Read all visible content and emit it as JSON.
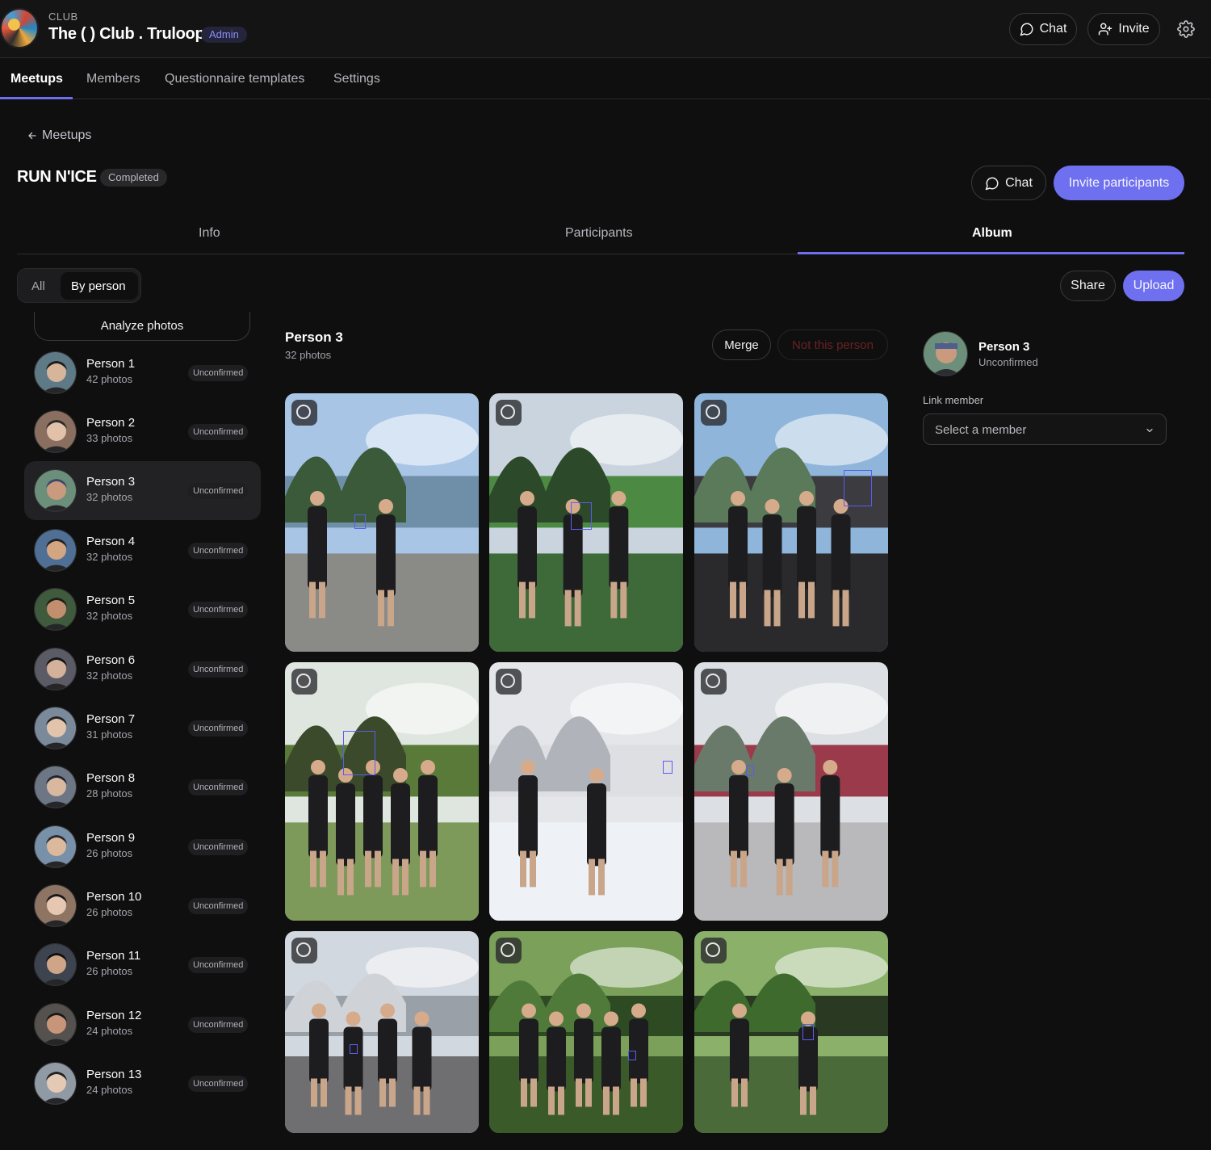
{
  "header": {
    "kicker": "CLUB",
    "club_name": "The ( ) Club . Truloop",
    "role_badge": "Admin",
    "chat_label": "Chat",
    "invite_label": "Invite"
  },
  "main_nav": [
    "Meetups",
    "Members",
    "Questionnaire templates",
    "Settings"
  ],
  "back_label": "Meetups",
  "event": {
    "title": "RUN N'ICE",
    "status": "Completed",
    "chat_label": "Chat",
    "invite_label": "Invite participants"
  },
  "sub_tabs": [
    "Info",
    "Participants",
    "Album"
  ],
  "album": {
    "filter_all": "All",
    "filter_person": "By person",
    "share_label": "Share",
    "upload_label": "Upload",
    "analyze_label": "Analyze photos"
  },
  "people": [
    {
      "name": "Person 1",
      "count": "42 photos",
      "status": "Unconfirmed"
    },
    {
      "name": "Person 2",
      "count": "33 photos",
      "status": "Unconfirmed"
    },
    {
      "name": "Person 3",
      "count": "32 photos",
      "status": "Unconfirmed"
    },
    {
      "name": "Person 4",
      "count": "32 photos",
      "status": "Unconfirmed"
    },
    {
      "name": "Person 5",
      "count": "32 photos",
      "status": "Unconfirmed"
    },
    {
      "name": "Person 6",
      "count": "32 photos",
      "status": "Unconfirmed"
    },
    {
      "name": "Person 7",
      "count": "31 photos",
      "status": "Unconfirmed"
    },
    {
      "name": "Person 8",
      "count": "28 photos",
      "status": "Unconfirmed"
    },
    {
      "name": "Person 9",
      "count": "26 photos",
      "status": "Unconfirmed"
    },
    {
      "name": "Person 10",
      "count": "26 photos",
      "status": "Unconfirmed"
    },
    {
      "name": "Person 11",
      "count": "26 photos",
      "status": "Unconfirmed"
    },
    {
      "name": "Person 12",
      "count": "24 photos",
      "status": "Unconfirmed"
    },
    {
      "name": "Person 13",
      "count": "24 photos",
      "status": "Unconfirmed"
    }
  ],
  "selected": {
    "name": "Person 3",
    "count": "32 photos",
    "status": "Unconfirmed",
    "merge_label": "Merge",
    "not_this_label": "Not this person",
    "link_label": "Link member",
    "select_placeholder": "Select a member"
  },
  "colors": {
    "accent": "#6e70ef",
    "background": "#0f0f10",
    "danger_muted": "#6a2222"
  }
}
